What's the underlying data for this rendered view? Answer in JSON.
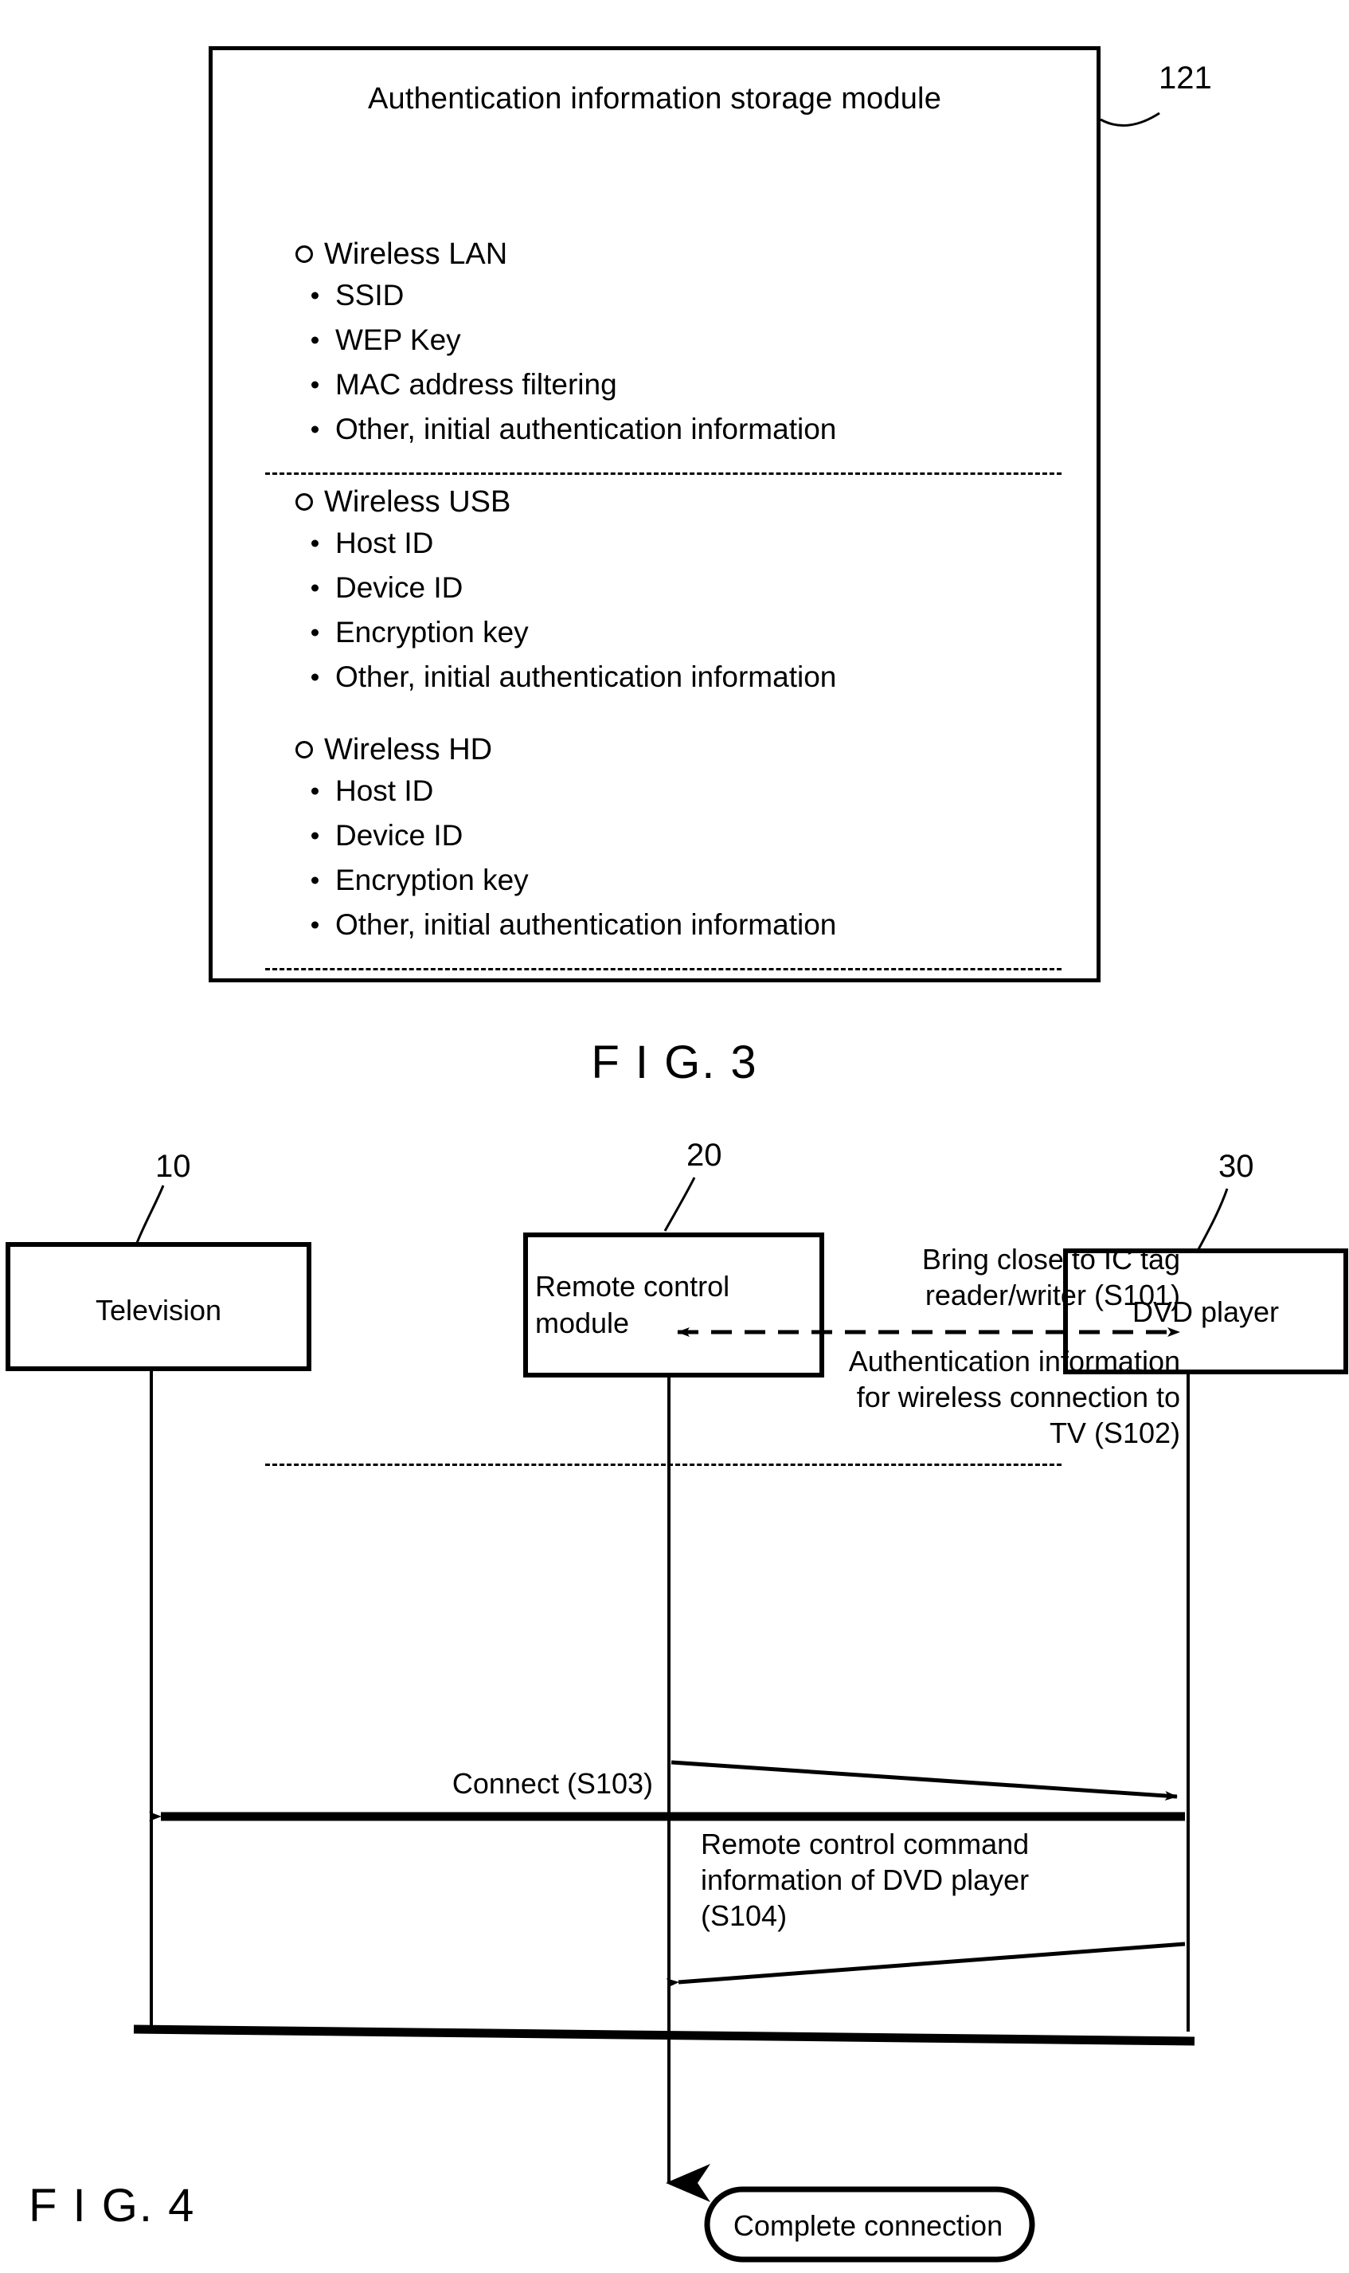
{
  "figure3": {
    "caption": "F I G. 3",
    "box_title": "Authentication information storage module",
    "reference_number": "121",
    "sections": [
      {
        "name": "Wireless LAN",
        "items": [
          "SSID",
          "WEP Key",
          "MAC address filtering",
          "Other, initial authentication information"
        ]
      },
      {
        "name": "Wireless USB",
        "items": [
          "Host ID",
          "Device ID",
          "Encryption key",
          "Other, initial authentication information"
        ]
      },
      {
        "name": "Wireless HD",
        "items": [
          "Host ID",
          "Device ID",
          "Encryption key",
          "Other, initial authentication information"
        ]
      }
    ]
  },
  "figure4": {
    "caption": "F I G. 4",
    "nodes": [
      {
        "label": "Television",
        "reference_number": "10"
      },
      {
        "label": "Remote control\nmodule",
        "reference_number": "20"
      },
      {
        "label": "DVD player",
        "reference_number": "30"
      }
    ],
    "messages": [
      {
        "step": "S101",
        "text": "Bring close to IC tag\nreader/writer (S101)",
        "from": "Remote control module",
        "to": "DVD player",
        "style": "dashed-double-arrow"
      },
      {
        "step": "S102",
        "text": "Authentication information\nfor wireless connection to\nTV (S102)",
        "from": "Remote control module",
        "to": "DVD player",
        "style": "solid-arrow"
      },
      {
        "step": "S103",
        "text": "Connect (S103)",
        "from": "DVD player",
        "to": "Television",
        "style": "solid-arrow-thick"
      },
      {
        "step": "S104",
        "text": "Remote control command\ninformation of DVD player\n(S104)",
        "from": "DVD player",
        "to": "Remote control module",
        "style": "solid-arrow"
      }
    ],
    "terminator": "Complete connection"
  }
}
